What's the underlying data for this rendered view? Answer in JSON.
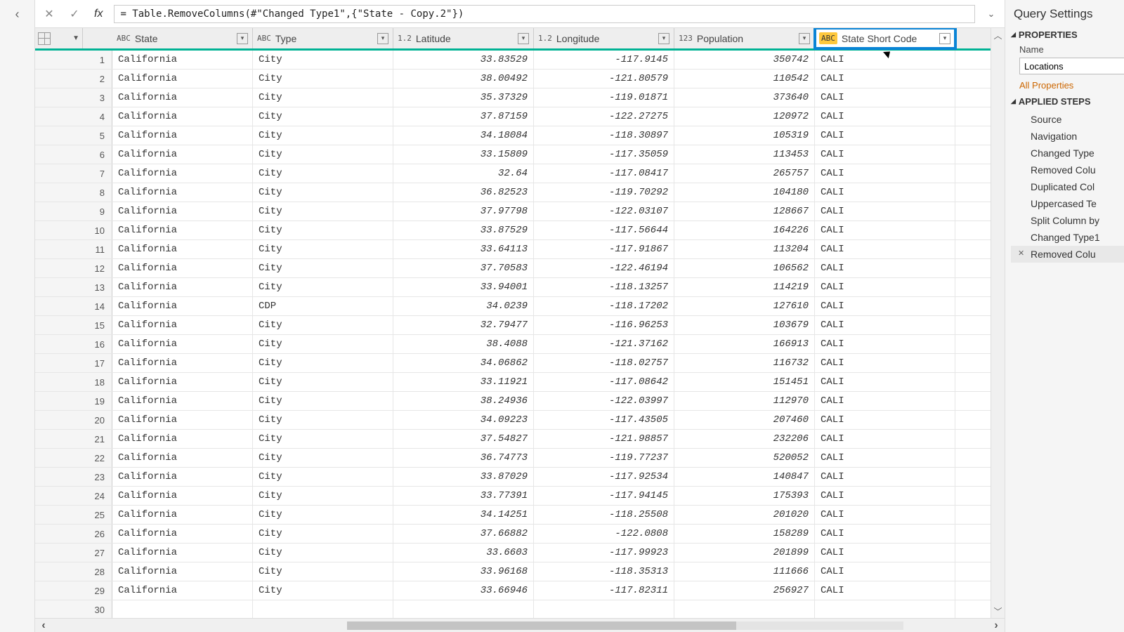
{
  "formula": "= Table.RemoveColumns(#\"Changed Type1\",{\"State - Copy.2\"})",
  "columns": [
    {
      "type": "ABC",
      "label": "State"
    },
    {
      "type": "ABC",
      "label": "Type"
    },
    {
      "type": "1.2",
      "label": "Latitude"
    },
    {
      "type": "1.2",
      "label": "Longitude"
    },
    {
      "type": "123",
      "label": "Population"
    },
    {
      "type": "ABC",
      "label": "State Short Code"
    }
  ],
  "rows": [
    [
      "California",
      "City",
      "33.83529",
      "-117.9145",
      "350742",
      "CALI"
    ],
    [
      "California",
      "City",
      "38.00492",
      "-121.80579",
      "110542",
      "CALI"
    ],
    [
      "California",
      "City",
      "35.37329",
      "-119.01871",
      "373640",
      "CALI"
    ],
    [
      "California",
      "City",
      "37.87159",
      "-122.27275",
      "120972",
      "CALI"
    ],
    [
      "California",
      "City",
      "34.18084",
      "-118.30897",
      "105319",
      "CALI"
    ],
    [
      "California",
      "City",
      "33.15809",
      "-117.35059",
      "113453",
      "CALI"
    ],
    [
      "California",
      "City",
      "32.64",
      "-117.08417",
      "265757",
      "CALI"
    ],
    [
      "California",
      "City",
      "36.82523",
      "-119.70292",
      "104180",
      "CALI"
    ],
    [
      "California",
      "City",
      "37.97798",
      "-122.03107",
      "128667",
      "CALI"
    ],
    [
      "California",
      "City",
      "33.87529",
      "-117.56644",
      "164226",
      "CALI"
    ],
    [
      "California",
      "City",
      "33.64113",
      "-117.91867",
      "113204",
      "CALI"
    ],
    [
      "California",
      "City",
      "37.70583",
      "-122.46194",
      "106562",
      "CALI"
    ],
    [
      "California",
      "City",
      "33.94001",
      "-118.13257",
      "114219",
      "CALI"
    ],
    [
      "California",
      "CDP",
      "34.0239",
      "-118.17202",
      "127610",
      "CALI"
    ],
    [
      "California",
      "City",
      "32.79477",
      "-116.96253",
      "103679",
      "CALI"
    ],
    [
      "California",
      "City",
      "38.4088",
      "-121.37162",
      "166913",
      "CALI"
    ],
    [
      "California",
      "City",
      "34.06862",
      "-118.02757",
      "116732",
      "CALI"
    ],
    [
      "California",
      "City",
      "33.11921",
      "-117.08642",
      "151451",
      "CALI"
    ],
    [
      "California",
      "City",
      "38.24936",
      "-122.03997",
      "112970",
      "CALI"
    ],
    [
      "California",
      "City",
      "34.09223",
      "-117.43505",
      "207460",
      "CALI"
    ],
    [
      "California",
      "City",
      "37.54827",
      "-121.98857",
      "232206",
      "CALI"
    ],
    [
      "California",
      "City",
      "36.74773",
      "-119.77237",
      "520052",
      "CALI"
    ],
    [
      "California",
      "City",
      "33.87029",
      "-117.92534",
      "140847",
      "CALI"
    ],
    [
      "California",
      "City",
      "33.77391",
      "-117.94145",
      "175393",
      "CALI"
    ],
    [
      "California",
      "City",
      "34.14251",
      "-118.25508",
      "201020",
      "CALI"
    ],
    [
      "California",
      "City",
      "37.66882",
      "-122.0808",
      "158289",
      "CALI"
    ],
    [
      "California",
      "City",
      "33.6603",
      "-117.99923",
      "201899",
      "CALI"
    ],
    [
      "California",
      "City",
      "33.96168",
      "-118.35313",
      "111666",
      "CALI"
    ],
    [
      "California",
      "City",
      "33.66946",
      "-117.82311",
      "256927",
      "CALI"
    ],
    [
      "",
      "",
      "",
      "",
      "",
      ""
    ]
  ],
  "querySettings": {
    "title": "Query Settings",
    "propertiesHead": "PROPERTIES",
    "nameLabel": "Name",
    "nameValue": "Locations",
    "allProperties": "All Properties",
    "appliedStepsHead": "APPLIED STEPS",
    "steps": [
      "Source",
      "Navigation",
      "Changed Type",
      "Removed Colu",
      "Duplicated Col",
      "Uppercased Te",
      "Split Column by",
      "Changed Type1",
      "Removed Colu"
    ]
  }
}
